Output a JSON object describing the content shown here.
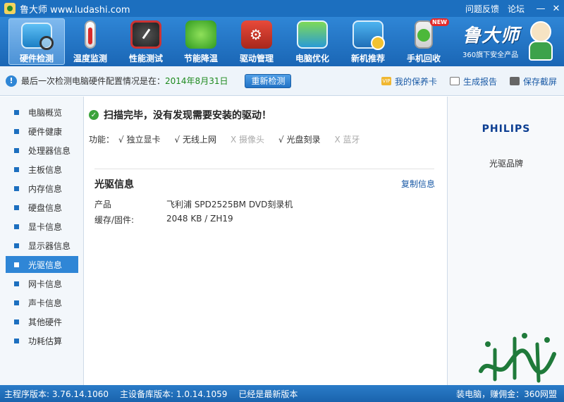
{
  "titlebar": {
    "title": "鲁大师 www.ludashi.com",
    "links": [
      "问题反馈",
      "论坛"
    ],
    "controls": [
      "—",
      "✕"
    ]
  },
  "toolbar": {
    "items": [
      {
        "label": "硬件检测",
        "icon": "hardware-monitor-icon"
      },
      {
        "label": "温度监测",
        "icon": "thermometer-icon"
      },
      {
        "label": "性能测试",
        "icon": "gauge-icon"
      },
      {
        "label": "节能降温",
        "icon": "leaf-icon"
      },
      {
        "label": "驱动管理",
        "icon": "gear-box-icon"
      },
      {
        "label": "电脑优化",
        "icon": "screen-optimize-icon"
      },
      {
        "label": "新机推荐",
        "icon": "monitor-badge-icon"
      },
      {
        "label": "手机回收",
        "icon": "phone-icon",
        "badge": "NEW"
      }
    ],
    "brand_name": "鲁大师",
    "brand_sub": "360旗下安全产品"
  },
  "infobar": {
    "text": "最后一次检测电脑硬件配置情况是在：",
    "date": "2014年8月31日",
    "rescan": "重新检测",
    "links": [
      {
        "label": "我的保养卡",
        "icon": "vip-card-icon"
      },
      {
        "label": "生成报告",
        "icon": "report-icon"
      },
      {
        "label": "保存截屏",
        "icon": "camera-icon"
      }
    ]
  },
  "sidebar": {
    "items": [
      "电脑概览",
      "硬件健康",
      "处理器信息",
      "主板信息",
      "内存信息",
      "硬盘信息",
      "显卡信息",
      "显示器信息",
      "光驱信息",
      "网卡信息",
      "声卡信息",
      "其他硬件",
      "功耗估算"
    ],
    "active_index": 8
  },
  "main": {
    "scan_status": "扫描完毕，没有发现需要安装的驱动！",
    "features_label": "功能：",
    "features": [
      {
        "label": "√ 独立显卡",
        "on": true
      },
      {
        "label": "√ 无线上网",
        "on": true
      },
      {
        "label": "X 摄像头",
        "on": false
      },
      {
        "label": "√ 光盘刻录",
        "on": true
      },
      {
        "label": "X 蓝牙",
        "on": false
      }
    ],
    "section_title": "光驱信息",
    "copy_label": "复制信息",
    "rows": [
      {
        "key": "产品",
        "value": "飞利浦 SPD2525BM DVD刻录机"
      },
      {
        "key": "缓存/固件:",
        "value": "2048 KB / ZH19"
      }
    ]
  },
  "rightpanel": {
    "brand_logo": "PHILIPS",
    "brand_label": "光驱品牌"
  },
  "statusbar": {
    "main_version": "主程序版本: 3.76.14.1060",
    "db_version": "主设备库版本: 1.0.14.1059",
    "latest": "已经是最新版本",
    "right_text": "装电脑，赚佣金：360网盟"
  }
}
